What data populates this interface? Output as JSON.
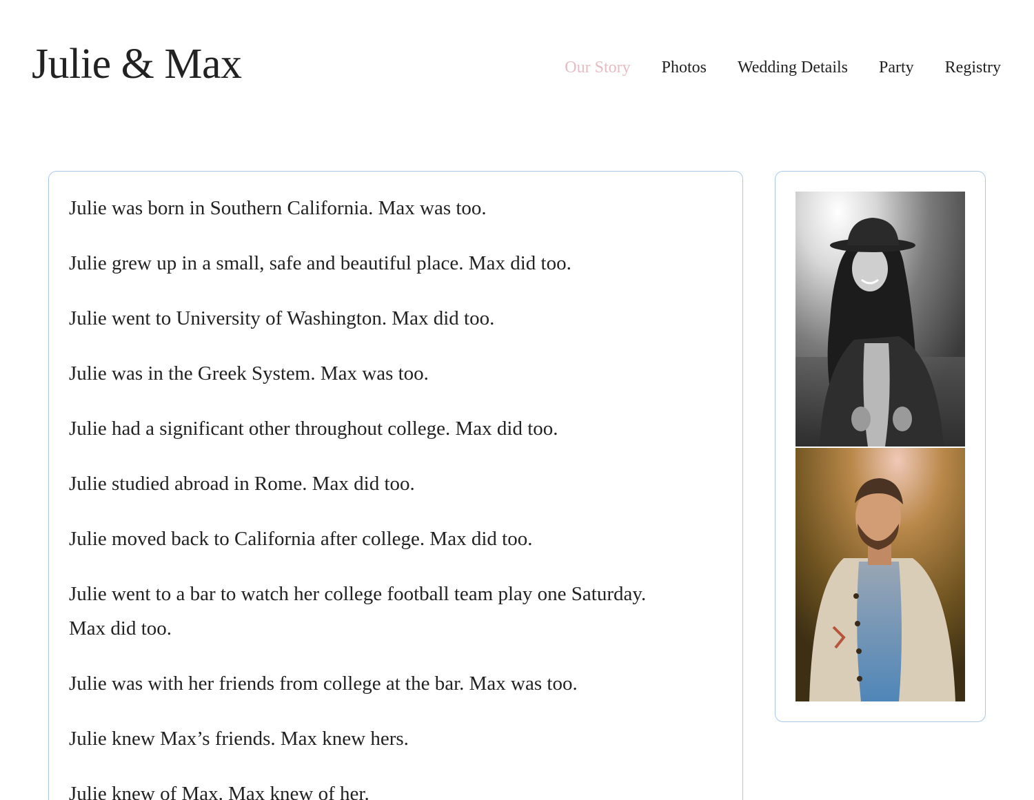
{
  "header": {
    "site_title": "Julie & Max"
  },
  "nav": {
    "items": [
      {
        "label": "Our Story",
        "active": true
      },
      {
        "label": "Photos",
        "active": false
      },
      {
        "label": "Wedding Details",
        "active": false
      },
      {
        "label": "Party",
        "active": false
      },
      {
        "label": "Registry",
        "active": false
      }
    ]
  },
  "story": {
    "paragraphs": [
      "Julie was born in Southern California. Max was too.",
      "Julie grew up in a small, safe and beautiful place. Max did too.",
      "Julie went to University of Washington. Max did too.",
      "Julie was in the Greek System. Max was too.",
      "Julie had a significant other throughout college. Max did too.",
      "Julie studied abroad in Rome. Max did too.",
      "Julie moved back to California after college. Max did too.",
      "Julie went to a bar to watch her college football team play one Saturday. Max did too.",
      "Julie was with her friends from college at the bar. Max was too.",
      "Julie knew Max’s friends. Max knew hers.",
      "Julie knew of Max. Max knew of her."
    ]
  },
  "colors": {
    "nav_active": "#e4bcc1",
    "card_border": "#a9c8e8",
    "text": "#222222"
  }
}
